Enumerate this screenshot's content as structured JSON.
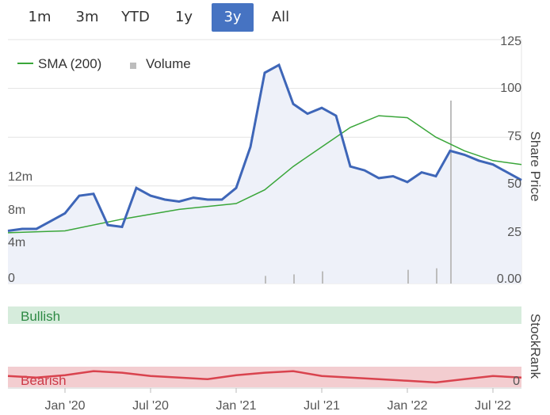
{
  "range_selector": {
    "buttons": [
      "1m",
      "3m",
      "YTD",
      "1y",
      "3y",
      "All"
    ],
    "selected": "3y"
  },
  "colors": {
    "price_line": "#3e66b8",
    "sma_line": "#3aa63a",
    "volume_bar": "#bdbdbd",
    "active_button": "#4673c2",
    "bullish_band": "#d6ecdc",
    "bearish_band": "#f3cdd0",
    "stockrank_line": "#d9434e",
    "stockrank_line_grey": "#9b9b9b",
    "price_fill": "#eef1f9"
  },
  "chart_data": [
    {
      "type": "line",
      "legend": [
        "SMA (200)",
        "Volume"
      ],
      "y_right_label": "Share Price",
      "y_right_ticks": [
        "125",
        "100",
        "75",
        "50",
        "25",
        "0.00"
      ],
      "y_left_ticks": [
        "12m",
        "8m",
        "4m",
        "0"
      ],
      "x_ticks": [
        "Jan '20",
        "Jul '20",
        "Jan '21",
        "Jul '21",
        "Jan '22",
        "Jul '22"
      ],
      "y_range": [
        0,
        125
      ],
      "volume_range": [
        0,
        16
      ],
      "price": {
        "x": [
          "2019-09",
          "2019-10",
          "2019-11",
          "2019-12",
          "2020-01",
          "2020-02",
          "2020-03",
          "2020-04",
          "2020-05",
          "2020-06",
          "2020-07",
          "2020-08",
          "2020-09",
          "2020-10",
          "2020-11",
          "2020-12",
          "2021-01",
          "2021-02",
          "2021-03",
          "2021-04",
          "2021-05",
          "2021-06",
          "2021-07",
          "2021-08",
          "2021-09",
          "2021-10",
          "2021-11",
          "2021-12",
          "2022-01",
          "2022-02",
          "2022-03",
          "2022-04",
          "2022-05",
          "2022-06",
          "2022-07",
          "2022-08",
          "2022-09"
        ],
        "y": [
          27,
          28,
          28,
          32,
          36,
          45,
          46,
          30,
          29,
          49,
          45,
          43,
          42,
          44,
          43,
          43,
          49,
          70,
          108,
          112,
          92,
          87,
          90,
          86,
          60,
          58,
          54,
          55,
          52,
          57,
          55,
          68,
          66,
          63,
          61,
          57,
          53
        ]
      },
      "sma_200": {
        "x": [
          "2019-09",
          "2020-01",
          "2020-05",
          "2020-09",
          "2021-01",
          "2021-03",
          "2021-05",
          "2021-07",
          "2021-09",
          "2021-11",
          "2022-01",
          "2022-03",
          "2022-05",
          "2022-07",
          "2022-09"
        ],
        "y": [
          26,
          27,
          33,
          38,
          41,
          48,
          60,
          70,
          80,
          86,
          85,
          75,
          68,
          63,
          61
        ]
      },
      "volume_spikes": [
        {
          "x": "2021-03",
          "v": 0.5
        },
        {
          "x": "2021-05",
          "v": 0.6
        },
        {
          "x": "2021-07",
          "v": 0.8
        },
        {
          "x": "2022-01",
          "v": 0.9
        },
        {
          "x": "2022-03",
          "v": 1.0
        },
        {
          "x": "2022-04",
          "v": 12
        }
      ]
    },
    {
      "type": "line",
      "y_right_label": "StockRank",
      "y_right_ticks": [
        "0"
      ],
      "bands": [
        "Bullish",
        "Bearish"
      ],
      "stockrank": {
        "x": [
          "2019-09",
          "2019-11",
          "2020-01",
          "2020-03",
          "2020-05",
          "2020-07",
          "2020-09",
          "2020-11",
          "2021-01",
          "2021-03",
          "2021-05",
          "2021-07",
          "2021-09",
          "2021-11",
          "2022-01",
          "2022-03",
          "2022-05",
          "2022-07",
          "2022-09"
        ],
        "y": [
          14,
          12,
          15,
          20,
          18,
          14,
          12,
          10,
          15,
          18,
          20,
          14,
          12,
          10,
          8,
          6,
          10,
          14,
          12
        ]
      }
    }
  ]
}
